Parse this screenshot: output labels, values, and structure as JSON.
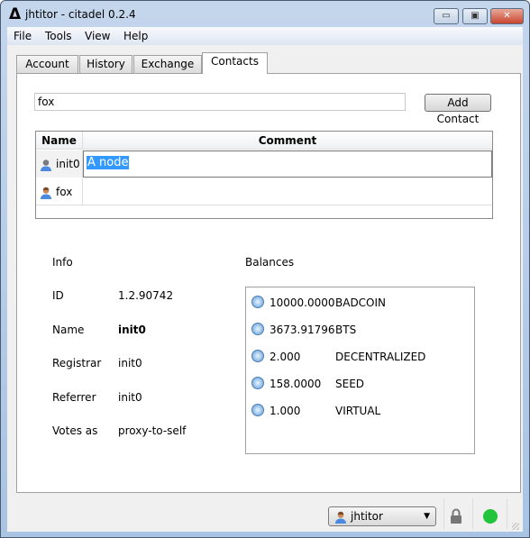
{
  "window": {
    "title": "jhtitor - citadel 0.2.4",
    "logo": "Δ",
    "minimize": "▭",
    "maximize": "▣",
    "close": "✕"
  },
  "menu": [
    "File",
    "Tools",
    "View",
    "Help"
  ],
  "tabs": [
    {
      "label": "Account"
    },
    {
      "label": "History"
    },
    {
      "label": "Exchange"
    },
    {
      "label": "Contacts",
      "active": true
    }
  ],
  "contacts": {
    "search_value": "fox",
    "add_button": "Add Contact",
    "columns": [
      "Name",
      "Comment"
    ],
    "rows": [
      {
        "name": "init0",
        "comment": "A node",
        "editing": true
      },
      {
        "name": "fox",
        "comment": ""
      }
    ]
  },
  "info": {
    "heading": "Info",
    "fields": [
      {
        "label": "ID",
        "value": "1.2.90742"
      },
      {
        "label": "Name",
        "value": "init0"
      },
      {
        "label": "Registrar",
        "value": "init0"
      },
      {
        "label": "Referrer",
        "value": "init0"
      },
      {
        "label": "Votes as",
        "value": "proxy-to-self"
      }
    ]
  },
  "balances": {
    "heading": "Balances",
    "items": [
      {
        "amount": "10000.0000",
        "symbol": "BADCOIN"
      },
      {
        "amount": "3673.91796",
        "symbol": "BTS"
      },
      {
        "amount": "2.000",
        "symbol": "DECENTRALIZED"
      },
      {
        "amount": "158.0000",
        "symbol": "SEED"
      },
      {
        "amount": "1.000",
        "symbol": "VIRTUAL"
      }
    ]
  },
  "statusbar": {
    "account": "jhtitor",
    "connection_color": "#22c43c",
    "lock_icon": "lock-icon"
  }
}
